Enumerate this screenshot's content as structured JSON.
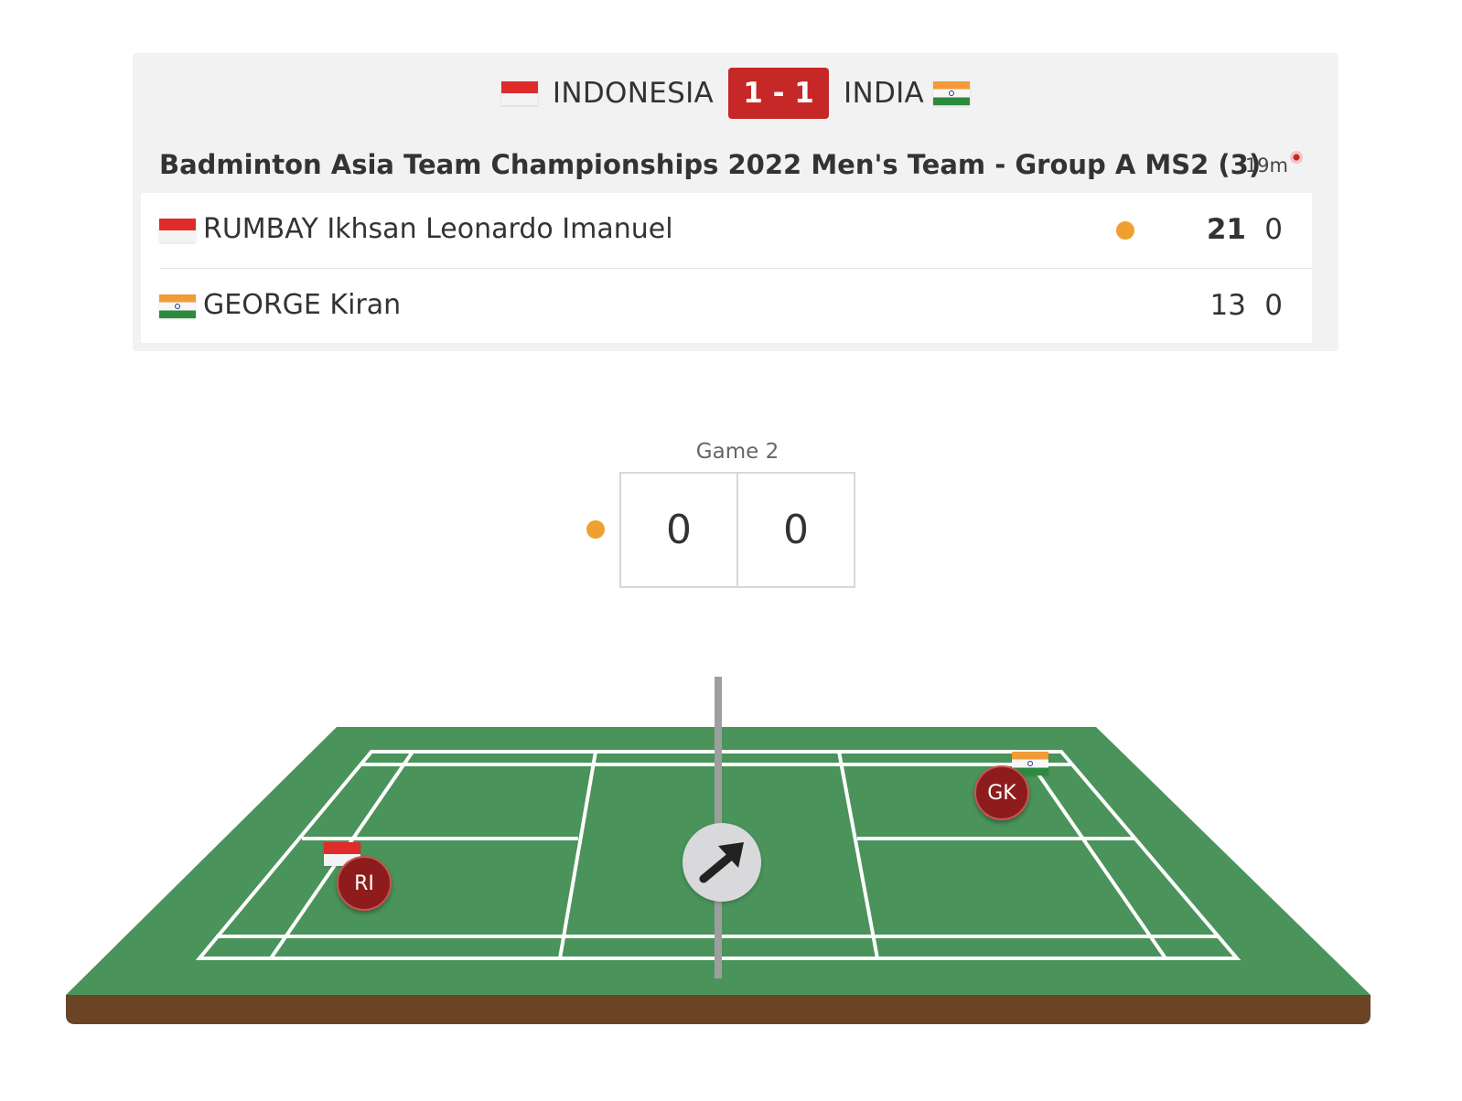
{
  "header": {
    "home_team": "INDONESIA",
    "away_team": "INDIA",
    "match_score": "1 - 1"
  },
  "event": {
    "title": "Badminton Asia Team Championships 2022 Men's Team - Group A MS2 (3)",
    "duration": "19m"
  },
  "players": [
    {
      "name": "RUMBAY Ikhsan Leonardo Imanuel",
      "country": "Indonesia",
      "game1": "21",
      "game2": "0",
      "serving": true
    },
    {
      "name": "GEORGE Kiran",
      "country": "India",
      "game1": "13",
      "game2": "0",
      "serving": false
    }
  ],
  "current_game": {
    "label": "Game 2",
    "home_score": "0",
    "away_score": "0"
  },
  "court": {
    "home_initials": "RI",
    "away_initials": "GK",
    "court_color": "#4a935b",
    "base_color": "#6b4426",
    "shuttle_icon": "arrow-up-right-icon"
  },
  "colors": {
    "accent_red": "#c62828",
    "serve_dot": "#f0a030"
  }
}
